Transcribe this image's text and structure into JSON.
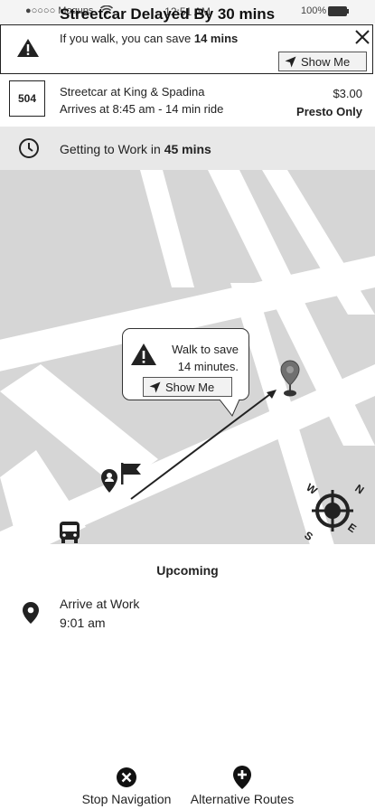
{
  "status_bar": {
    "carrier": "●○○○○ Moqups",
    "time": "12:51 AM",
    "battery": "100%"
  },
  "alert": {
    "title": "Streetcar Delayed By 30 mins",
    "subtitle_prefix": "If you walk, you can save ",
    "subtitle_bold": "14 mins",
    "show_me_label": "Show Me"
  },
  "route": {
    "number": "504",
    "line1": "Streetcar at King & Spadina",
    "line2": "Arrives at 8:45 am - 14 min ride",
    "fare": "$3.00",
    "fare_note": "Presto Only"
  },
  "trip": {
    "prefix": "Getting to Work in ",
    "duration": "45 mins"
  },
  "map": {
    "callout_line1": "Walk to save",
    "callout_line2": "14 minutes.",
    "callout_button": "Show Me",
    "compass": {
      "n": "N",
      "e": "E",
      "s": "S",
      "w": "W"
    }
  },
  "upcoming": {
    "heading": "Upcoming",
    "item_title": "Arrive at Work",
    "item_time": "9:01 am"
  },
  "actions": {
    "stop_label": "Stop Navigation",
    "alt_label": "Alternative Routes"
  },
  "icons": {
    "alert": "warning-triangle-icon",
    "close": "close-icon",
    "nav_arrow": "navigation-arrow-icon",
    "clock": "clock-icon",
    "pin": "map-pin-icon",
    "bus": "bus-icon",
    "flag": "flag-icon",
    "compass": "compass-icon",
    "stop": "close-circle-icon",
    "add_pin": "add-location-icon"
  }
}
